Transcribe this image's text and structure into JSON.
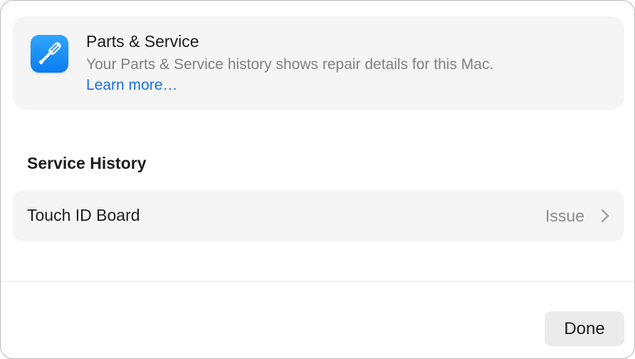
{
  "info_card": {
    "icon": "screwdriver-icon",
    "title": "Parts & Service",
    "description": "Your Parts & Service history shows repair details for this Mac.",
    "link": "Learn more…"
  },
  "service_history": {
    "header": "Service History",
    "items": [
      {
        "label": "Touch ID Board",
        "status": "Issue",
        "icon": "chevron-right-icon"
      }
    ]
  },
  "footer": {
    "done_label": "Done"
  },
  "colors": {
    "accent": "#1a6fe0",
    "icon_background": "#0a7cf0",
    "card_background": "#f5f5f5",
    "secondary_text": "#808080"
  }
}
